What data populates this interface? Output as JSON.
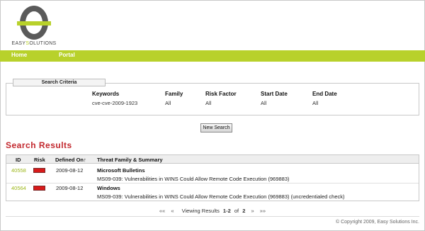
{
  "logo": {
    "text_pre": "EASY",
    "text_hl": "S",
    "text_post": "OLUTIONS"
  },
  "nav": {
    "items": [
      "Home",
      "Portal"
    ]
  },
  "criteria": {
    "legend": "Search Criteria",
    "columns": [
      {
        "label": "Keywords",
        "value": "cve-cve-2009-1923"
      },
      {
        "label": "Family",
        "value": "All"
      },
      {
        "label": "Risk Factor",
        "value": "All"
      },
      {
        "label": "Start Date",
        "value": "All"
      },
      {
        "label": "End Date",
        "value": "All"
      }
    ],
    "button": "New Search"
  },
  "results": {
    "title": "Search Results",
    "headers": [
      "ID",
      "Risk",
      "Defined On↑",
      "Threat Family & Summary"
    ],
    "rows": [
      {
        "id": "40558",
        "risk_color": "#d81a1a",
        "defined_on": "2009-08-12",
        "family": "Microsoft Bulletins",
        "summary": "MS09-039: Vulnerabilities in WINS Could Allow Remote Code Execution (969883)"
      },
      {
        "id": "40564",
        "risk_color": "#d81a1a",
        "defined_on": "2009-08-12",
        "family": "Windows",
        "summary": "MS09-039: Vulnerabilities in WINS Could Allow Remote Code Execution (969883) (uncredentialed check)"
      }
    ]
  },
  "pager": {
    "first": "««",
    "prev": "«",
    "text_pre": "Viewing Results",
    "range": "1-2",
    "text_of": "of",
    "total": "2",
    "next": "»",
    "last": "»»"
  },
  "footer": {
    "copyright": "© Copyright 2009, Easy Solutions Inc."
  },
  "colors": {
    "accent": "#b8d12b",
    "results_title": "#c2272d",
    "link": "#9db71b"
  }
}
